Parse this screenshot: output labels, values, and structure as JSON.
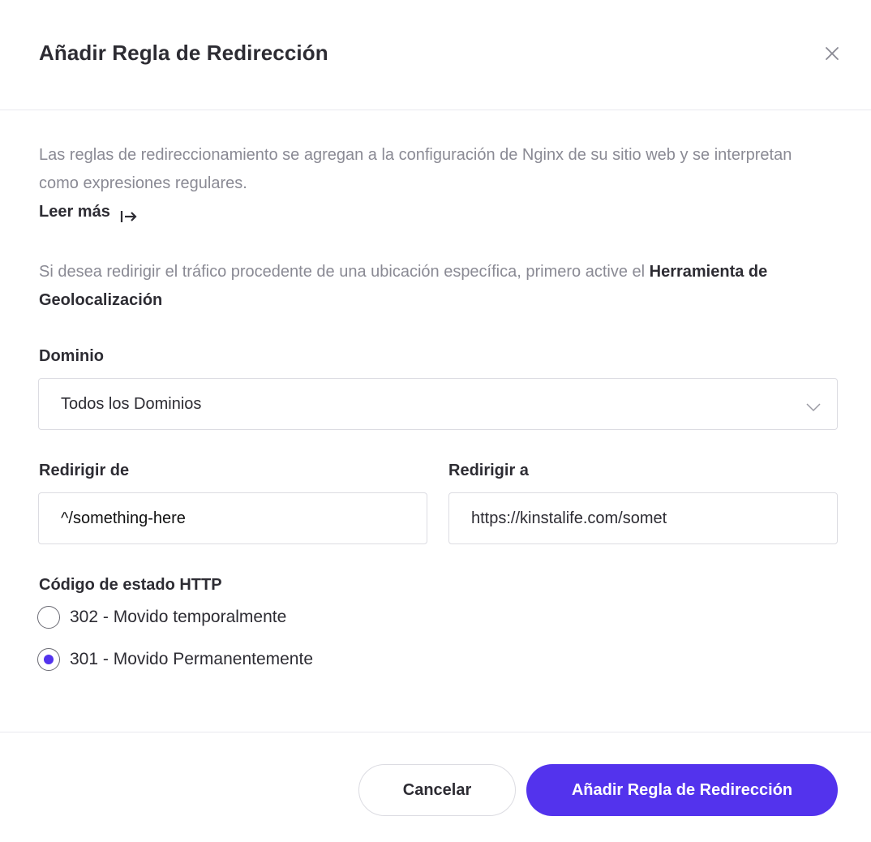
{
  "modal": {
    "title": "Añadir Regla de Redirección",
    "close_icon": "close-icon"
  },
  "intro": {
    "text": "Las reglas de redireccionamiento se agregan a la configuración de Nginx de su sitio web y se interpretan como expresiones regulares.",
    "read_more": "Leer más",
    "read_more_icon": "arrow-right-bar-icon"
  },
  "geo_notice": {
    "text": "Si desea redirigir el tráfico procedente de una ubicación específica, primero active el ",
    "link": "Herramienta de Geolocalización"
  },
  "domain": {
    "label": "Dominio",
    "selected": "Todos los Dominios",
    "chevron_icon": "chevron-down-icon"
  },
  "redirect_from": {
    "label": "Redirigir de",
    "value": "^/something-here"
  },
  "redirect_to": {
    "label": "Redirigir a",
    "value": "https://kinstalife.com/somet"
  },
  "http_status": {
    "label": "Código de estado HTTP",
    "options": [
      {
        "label": "302 - Movido temporalmente",
        "checked": false
      },
      {
        "label": "301 - Movido Permanentemente",
        "checked": true
      }
    ]
  },
  "footer": {
    "cancel_label": "Cancelar",
    "submit_label": "Añadir Regla de Redirección"
  },
  "colors": {
    "accent": "#5333ed",
    "text": "#2d2c33",
    "muted": "#8a8a94",
    "border": "#dcdce2"
  }
}
